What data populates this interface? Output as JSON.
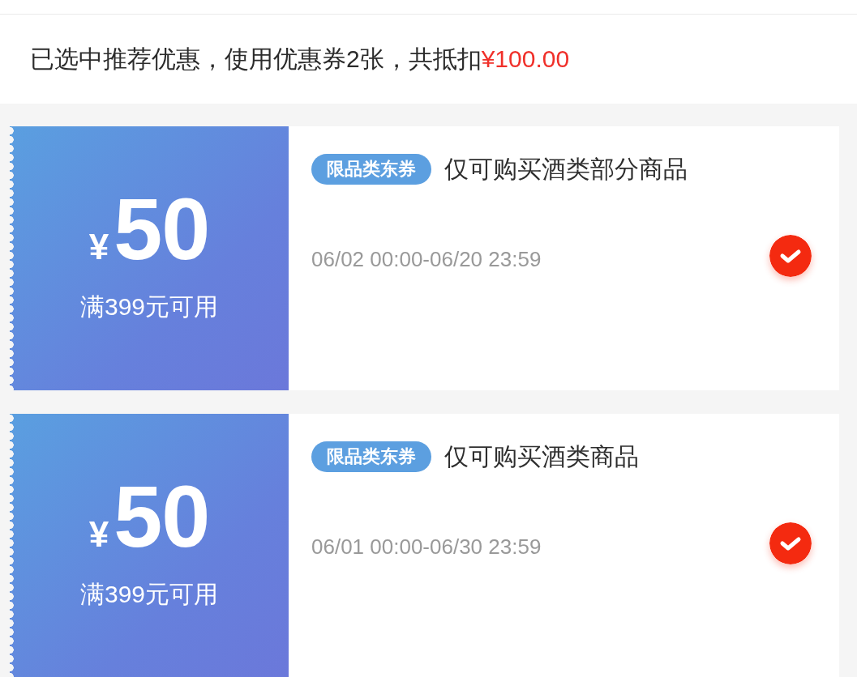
{
  "summary": {
    "text": "已选中推荐优惠，使用优惠券2张，共抵扣",
    "amount": "¥100.00"
  },
  "coupons": [
    {
      "currency": "¥",
      "value": "50",
      "condition": "满399元可用",
      "tag": "限品类东券",
      "title": "仅可购买酒类部分商品",
      "validity": "06/02 00:00-06/20 23:59",
      "selected": true
    },
    {
      "currency": "¥",
      "value": "50",
      "condition": "满399元可用",
      "tag": "限品类东券",
      "title": "仅可购买酒类商品",
      "validity": "06/01 00:00-06/30 23:59",
      "selected": true
    }
  ]
}
